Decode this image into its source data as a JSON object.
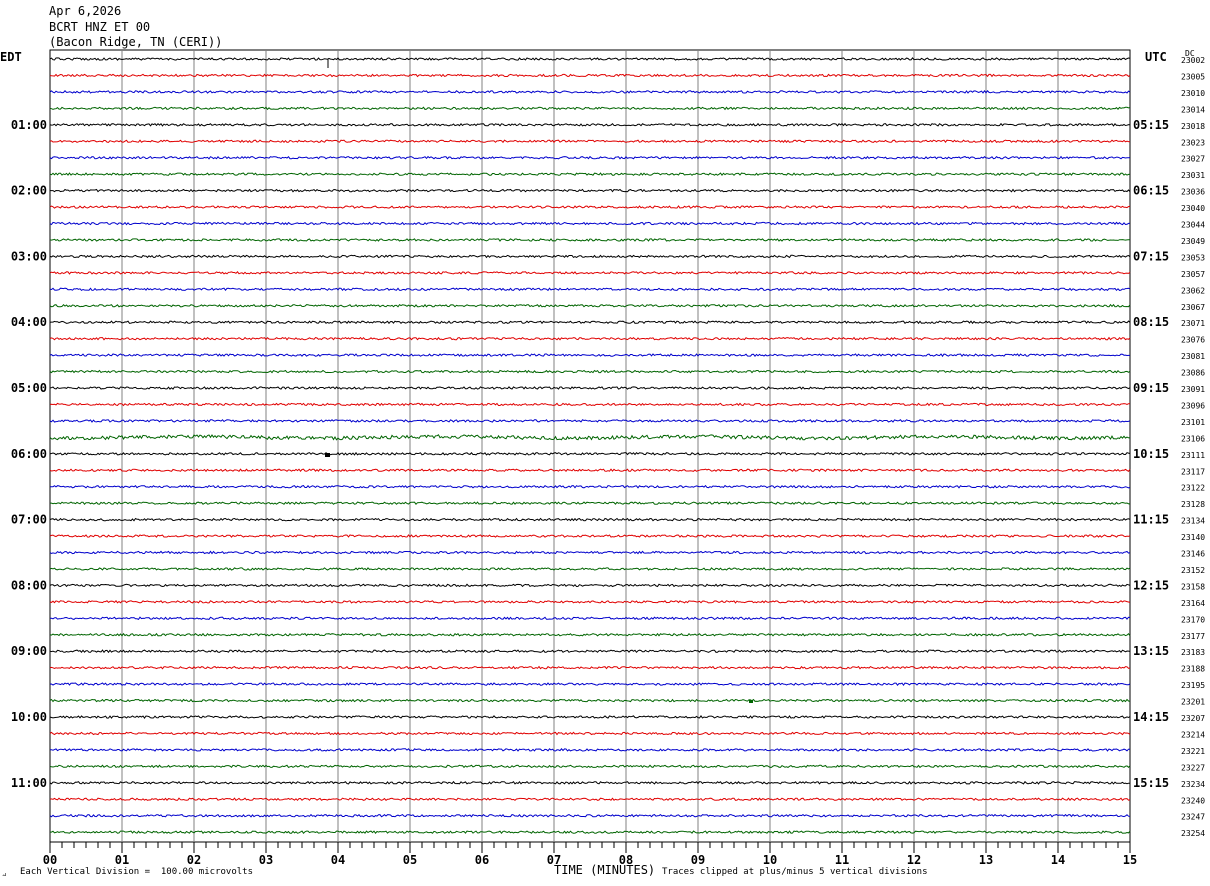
{
  "header": {
    "date": "Apr 6,2026",
    "station": "BCRT HNZ ET 00",
    "location": "(Bacon Ridge, TN (CERI))"
  },
  "left_tz": "EDT",
  "right_tz": "UTC",
  "corner_label": "DC",
  "footer": {
    "scale_note": "Each Vertical Division =  100.00 microvolts",
    "clip_note": "Traces clipped at plus/minus 5 vertical divisions",
    "corner_mark": "⟓"
  },
  "chart_data": {
    "type": "line",
    "title": "",
    "xlabel": "TIME (MINUTES)",
    "xlim": [
      0,
      15
    ],
    "x_ticks": [
      "00",
      "01",
      "02",
      "03",
      "04",
      "05",
      "06",
      "07",
      "08",
      "09",
      "10",
      "11",
      "12",
      "13",
      "14",
      "15"
    ],
    "trace_colors": [
      "#000000",
      "#e00000",
      "#0000cc",
      "#006400"
    ],
    "left_hour_labels": [
      "01:00",
      "02:00",
      "03:00",
      "04:00",
      "05:00",
      "06:00",
      "07:00",
      "08:00",
      "09:00",
      "10:00",
      "11:00"
    ],
    "right_hour_labels": [
      "05:15",
      "06:15",
      "07:15",
      "08:15",
      "09:15",
      "10:15",
      "11:15",
      "12:15",
      "13:15",
      "14:15",
      "15:15"
    ],
    "row_ids": [
      "23002",
      "23005",
      "23010",
      "23014",
      "23018",
      "23023",
      "23027",
      "23031",
      "23036",
      "23040",
      "23044",
      "23049",
      "23053",
      "23057",
      "23062",
      "23067",
      "23071",
      "23076",
      "23081",
      "23086",
      "23091",
      "23096",
      "23101",
      "23106",
      "23111",
      "23117",
      "23122",
      "23128",
      "23134",
      "23140",
      "23146",
      "23152",
      "23158",
      "23164",
      "23170",
      "23177",
      "23183",
      "23188",
      "23195",
      "23201",
      "23207",
      "23214",
      "23221",
      "23227",
      "23234",
      "23240",
      "23247",
      "23254"
    ]
  }
}
